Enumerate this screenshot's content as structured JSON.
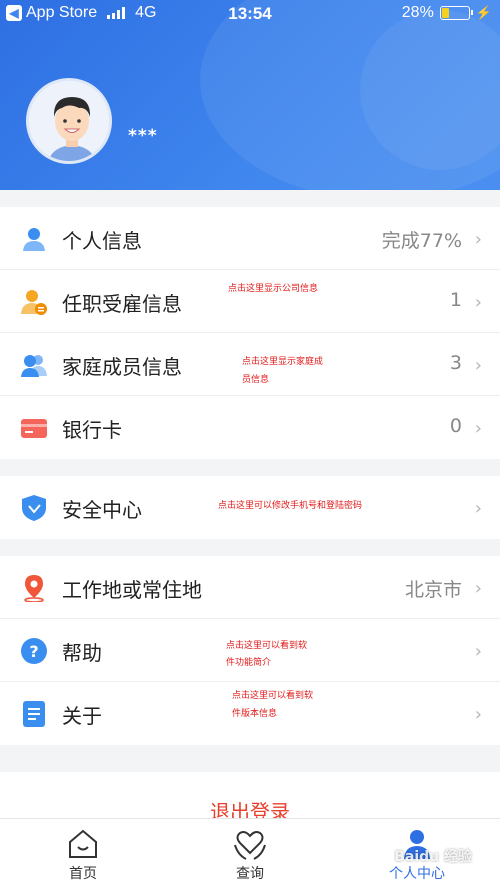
{
  "status_bar": {
    "back_app": "App Store",
    "network": "4G",
    "time": "13:54",
    "battery": "28%"
  },
  "profile": {
    "username": "",
    "phone": "***"
  },
  "groups": [
    {
      "items": [
        {
          "label": "个人信息",
          "value": "完成77%",
          "icon": "person-icon"
        },
        {
          "label": "任职受雇信息",
          "value": "1",
          "icon": "employment-icon"
        },
        {
          "label": "家庭成员信息",
          "value": "3",
          "icon": "family-icon"
        },
        {
          "label": "银行卡",
          "value": "0",
          "icon": "bank-card-icon"
        }
      ]
    },
    {
      "items": [
        {
          "label": "安全中心",
          "value": "",
          "icon": "shield-icon"
        }
      ]
    },
    {
      "items": [
        {
          "label": "工作地或常住地",
          "value": "北京市",
          "icon": "location-pin-icon"
        },
        {
          "label": "帮助",
          "value": "",
          "icon": "help-icon"
        },
        {
          "label": "关于",
          "value": "",
          "icon": "about-icon"
        }
      ]
    }
  ],
  "annotations": {
    "company": "点击这里显示公司信息",
    "family_1": "点击这里显示家庭成",
    "family_2": "员信息",
    "security": "点击这里可以修改手机号和登陆密码",
    "help_1": "点击这里可以看到软",
    "help_2": "件功能简介",
    "about_1": "点击这里可以看到软",
    "about_2": "件版本信息"
  },
  "logout_label": "退出登录",
  "tabs": [
    {
      "label": "首页",
      "icon": "home-icon"
    },
    {
      "label": "查询",
      "icon": "heart-hands-icon"
    },
    {
      "label": "个人中心",
      "icon": "user-icon"
    }
  ],
  "watermark": "Baidu 经验",
  "colors": {
    "header": "#3f86ee",
    "accent": "#2e6fe3",
    "logout": "#e8402c",
    "note": "#e11919"
  }
}
